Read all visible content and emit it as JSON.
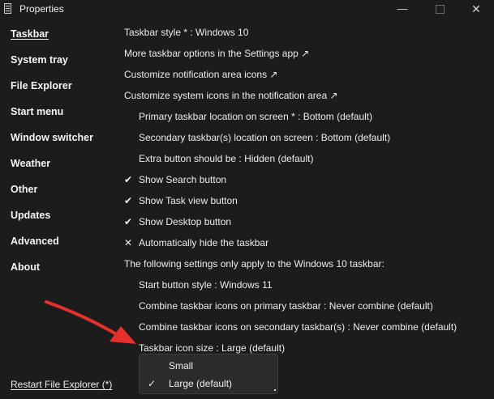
{
  "window": {
    "title": "Properties",
    "minimize_glyph": "—",
    "close_glyph": "✕"
  },
  "nav": [
    {
      "label": "Taskbar",
      "active": true
    },
    {
      "label": "System tray"
    },
    {
      "label": "File Explorer"
    },
    {
      "label": "Start menu"
    },
    {
      "label": "Window switcher"
    },
    {
      "label": "Weather"
    },
    {
      "label": "Other"
    },
    {
      "label": "Updates"
    },
    {
      "label": "Advanced"
    },
    {
      "label": "About"
    }
  ],
  "settings": {
    "taskbar_style": "Taskbar style * : Windows 10",
    "more_options": "More taskbar options in the Settings app ↗",
    "notif_icons": "Customize notification area icons ↗",
    "system_icons": "Customize system icons in the notification area ↗",
    "primary_location": "Primary taskbar location on screen * : Bottom (default)",
    "secondary_location": "Secondary taskbar(s) location on screen : Bottom (default)",
    "extra_button": "Extra button should be : Hidden (default)",
    "show_search": "Show Search button",
    "show_task_view": "Show Task view button",
    "show_desktop": "Show Desktop button",
    "auto_hide": "Automatically hide the taskbar",
    "win10_note": "The following settings only apply to the Windows 10 taskbar:",
    "start_style": "Start button style : Windows 11",
    "combine_primary": "Combine taskbar icons on primary taskbar : Never combine (default)",
    "combine_secondary": "Combine taskbar icons on secondary taskbar(s) : Never combine (default)",
    "icon_size": "Taskbar icon size : Large (default)"
  },
  "glyphs": {
    "checked": "✔",
    "unchecked": "✕",
    "selected": "✓"
  },
  "checkbox_states": {
    "show_search": true,
    "show_task_view": true,
    "show_desktop": true,
    "auto_hide": false
  },
  "dropdown": {
    "options": [
      "Small",
      "Large (default)"
    ],
    "selected": "Large (default)"
  },
  "footer": {
    "restart_label": "Restart File Explorer (*)"
  },
  "annotation": {
    "arrow_color": "#e8302a"
  }
}
